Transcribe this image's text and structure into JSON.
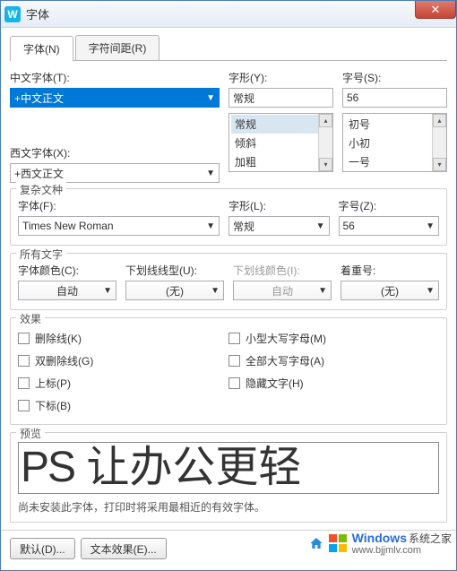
{
  "title": "字体",
  "tabs": [
    {
      "label": "字体(N)",
      "active": true
    },
    {
      "label": "字符间距(R)",
      "active": false
    }
  ],
  "section_main": {
    "chinese_font_label": "中文字体(T):",
    "chinese_font_value": "+中文正文",
    "style_label": "字形(Y):",
    "style_value": "常规",
    "style_options": [
      "常规",
      "倾斜",
      "加粗"
    ],
    "size_label": "字号(S):",
    "size_value": "56",
    "size_options": [
      "初号",
      "小初",
      "一号"
    ],
    "western_font_label": "西文字体(X):",
    "western_font_value": "+西文正文"
  },
  "complex": {
    "title": "复杂文种",
    "font_label": "字体(F):",
    "font_value": "Times New Roman",
    "style_label": "字形(L):",
    "style_value": "常规",
    "size_label": "字号(Z):",
    "size_value": "56"
  },
  "alltext": {
    "title": "所有文字",
    "color_label": "字体颜色(C):",
    "color_value": "自动",
    "underline_label": "下划线线型(U):",
    "underline_value": "(无)",
    "underline_color_label": "下划线颜色(I):",
    "underline_color_value": "自动",
    "emphasis_label": "着重号:",
    "emphasis_value": "(无)"
  },
  "effects": {
    "title": "效果",
    "left": [
      {
        "label": "删除线(K)"
      },
      {
        "label": "双删除线(G)"
      },
      {
        "label": "上标(P)"
      },
      {
        "label": "下标(B)"
      }
    ],
    "right": [
      {
        "label": "小型大写字母(M)"
      },
      {
        "label": "全部大写字母(A)"
      },
      {
        "label": "隐藏文字(H)"
      }
    ]
  },
  "preview": {
    "title": "预览",
    "text_ps": "PS",
    "text_cn": " 让办公更轻",
    "hint": "尚未安装此字体，打印时将采用最相近的有效字体。"
  },
  "buttons": {
    "default": "默认(D)...",
    "text_effects": "文本效果(E)..."
  },
  "watermark": {
    "brand": "Windows",
    "sub": "系统之家",
    "url": "www.bjjmlv.com"
  }
}
